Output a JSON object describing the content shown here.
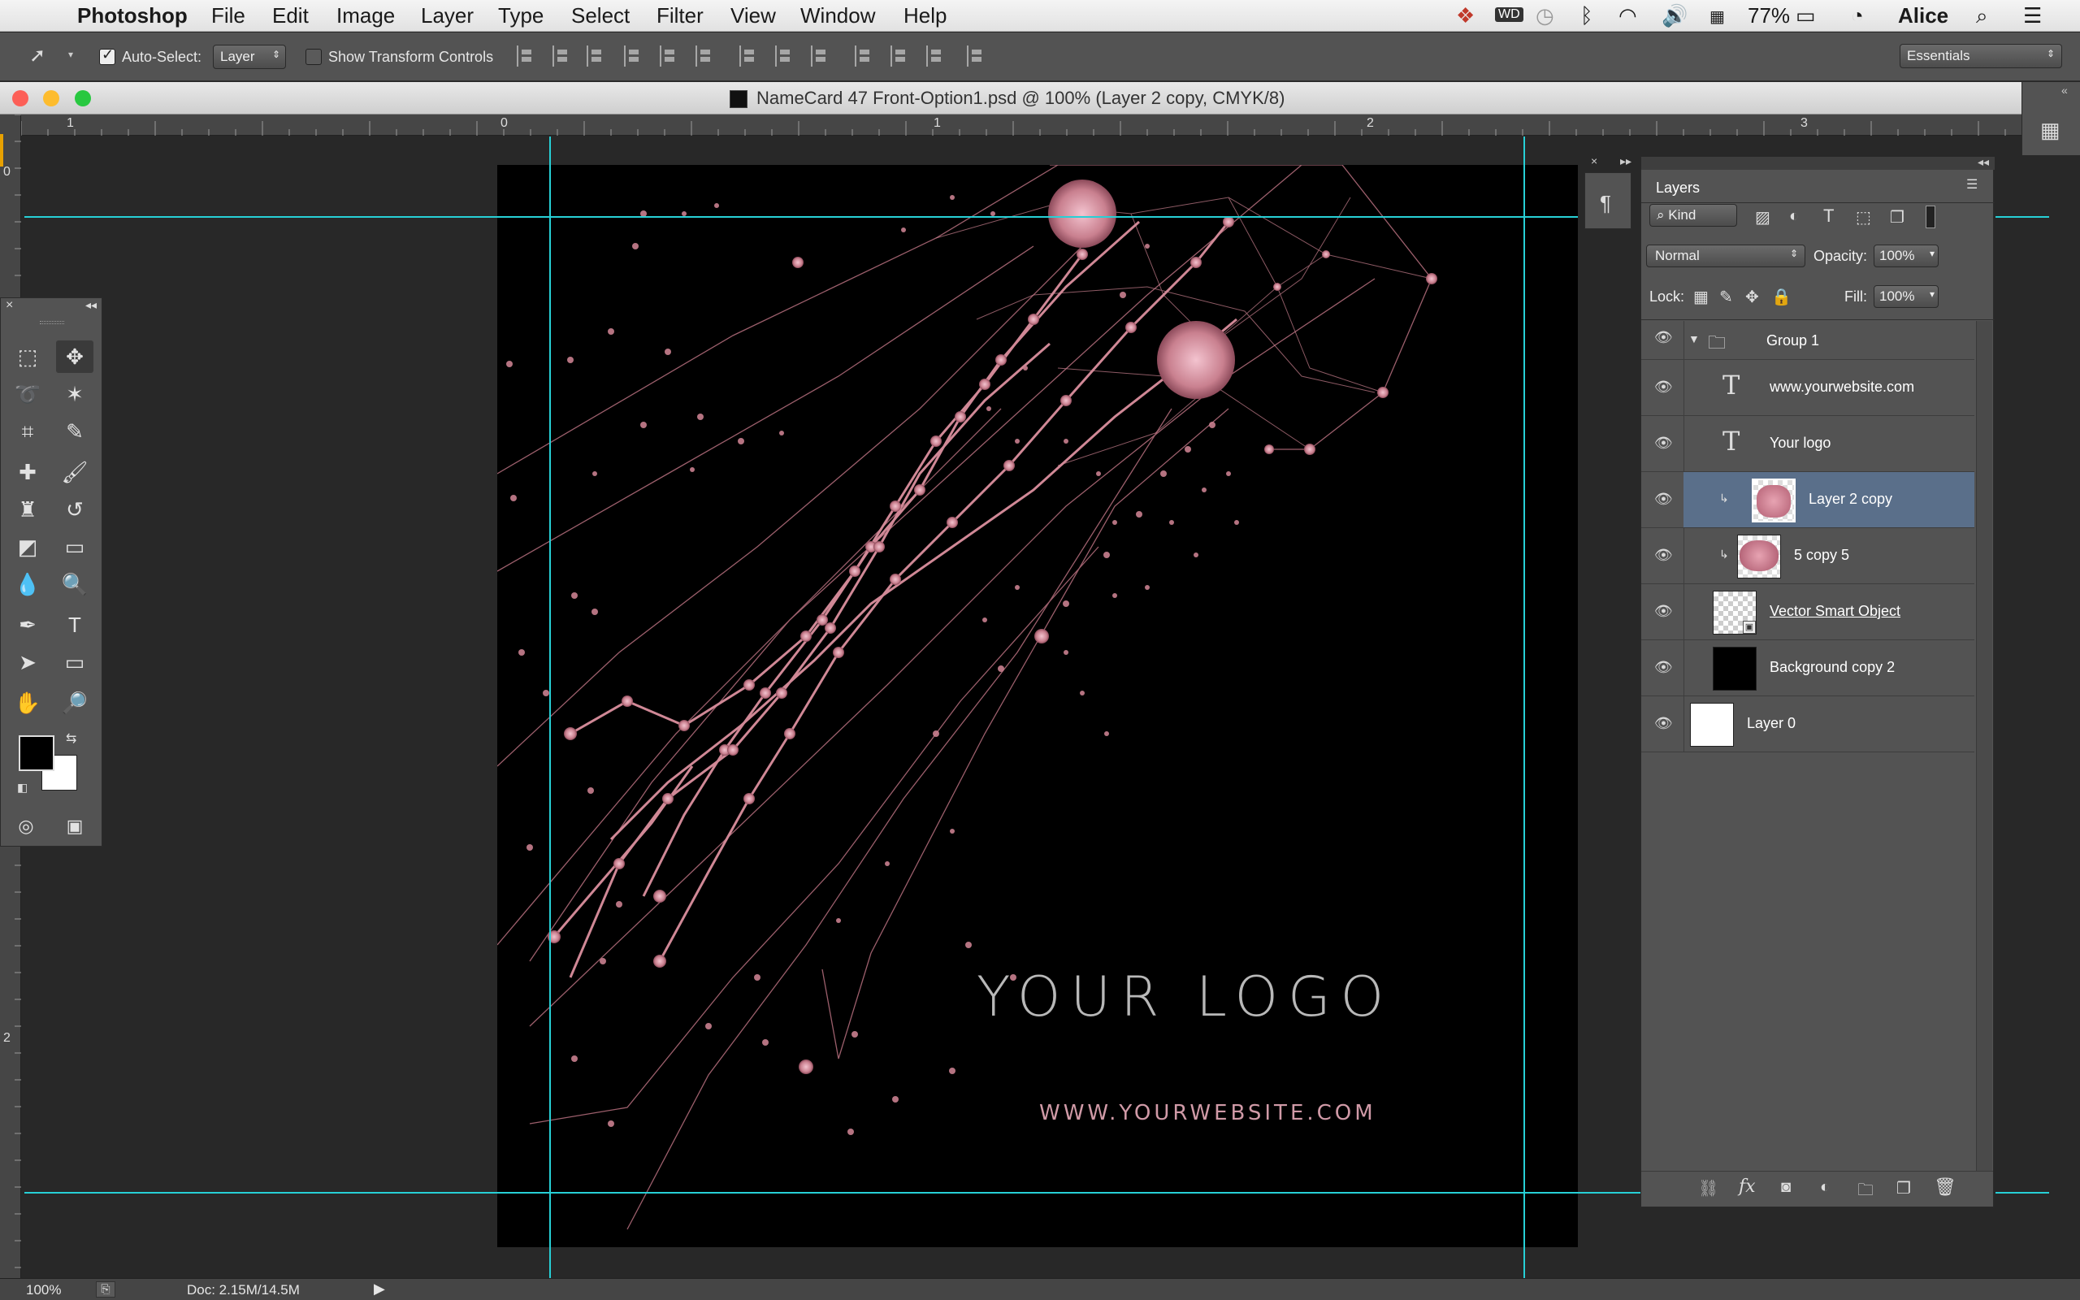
{
  "menubar": {
    "app_name": "Photoshop",
    "items": [
      "File",
      "Edit",
      "Image",
      "Layer",
      "Type",
      "Select",
      "Filter",
      "View",
      "Window",
      "Help"
    ],
    "battery": "77%",
    "user": "Alice"
  },
  "options_bar": {
    "auto_select_label": "Auto-Select:",
    "auto_select_value": "Layer",
    "show_transform_label": "Show Transform Controls",
    "workspace": "Essentials"
  },
  "document": {
    "title": "NameCard 47 Front-Option1.psd @ 100% (Layer 2 copy, CMYK/8)"
  },
  "rulers": {
    "h_labels": [
      "1",
      "0",
      "1",
      "2",
      "3"
    ],
    "v_labels": [
      "0",
      "2"
    ]
  },
  "canvas": {
    "logo_text": "YOUR LOGO",
    "website_text": "WWW.YOURWEBSITE.COM",
    "accent_color": "#c9808f",
    "guide_color": "#27d0d6"
  },
  "layers_panel": {
    "tab_label": "Layers",
    "filter_label": "Kind",
    "blend_mode": "Normal",
    "opacity_label": "Opacity:",
    "opacity_value": "100%",
    "lock_label": "Lock:",
    "fill_label": "Fill:",
    "fill_value": "100%",
    "group_name": "Group 1",
    "layers": [
      {
        "name": "www.yourwebsite.com",
        "kind": "text"
      },
      {
        "name": "Your logo",
        "kind": "text"
      },
      {
        "name": "Layer 2 copy",
        "kind": "raster",
        "selected": true
      },
      {
        "name": "5 copy 5",
        "kind": "raster"
      },
      {
        "name": "Vector Smart Object",
        "kind": "smart"
      },
      {
        "name": "Background copy 2",
        "kind": "raster"
      },
      {
        "name": "Layer 0",
        "kind": "raster"
      }
    ]
  },
  "status_bar": {
    "zoom": "100%",
    "doc_size": "Doc: 2.15M/14.5M"
  }
}
